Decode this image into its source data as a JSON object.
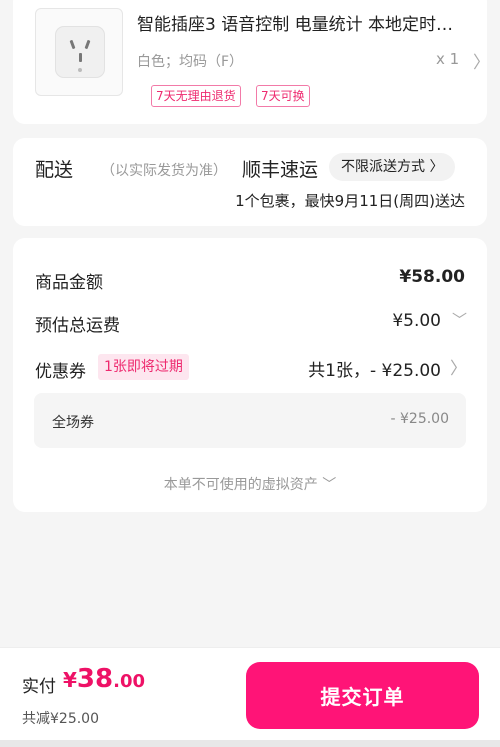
{
  "product": {
    "title": "智能插座3 语音控制 电量统计 本地定时…",
    "spec": "白色；均码（F）",
    "qty": "x 1",
    "arrow_icon": "chevron-right-icon",
    "image_icon": "smart-socket-image",
    "tags": [
      "7天无理由退货",
      "7天可换"
    ]
  },
  "delivery": {
    "label": "配送",
    "note": "（以实际发货为准）",
    "carrier": "顺丰速运",
    "method": "不限派送方式",
    "summary": "1个包裹，最快9月11日(周四)送达"
  },
  "price": {
    "goods_label": "商品金额",
    "goods_value": "¥58.00",
    "shipping_label": "预估总运费",
    "shipping_value": "¥5.00",
    "coupon_label": "优惠券",
    "coupon_badge": "1张即将过期",
    "coupon_value": "共1张，- ¥25.00",
    "coupon_item_name": "全场券",
    "coupon_item_amount": "- ¥25.00",
    "virtual_assets": "本单不可使用的虚拟资产"
  },
  "footer": {
    "pay_label": "实付",
    "currency": "¥",
    "amount_int": "38",
    "amount_dec": ".00",
    "reduced": "共减¥25.00",
    "submit_label": "提交订单"
  },
  "colors": {
    "accent": "#ff1477",
    "tag_text": "#ee2a6f",
    "background": "#f5f5f5"
  }
}
